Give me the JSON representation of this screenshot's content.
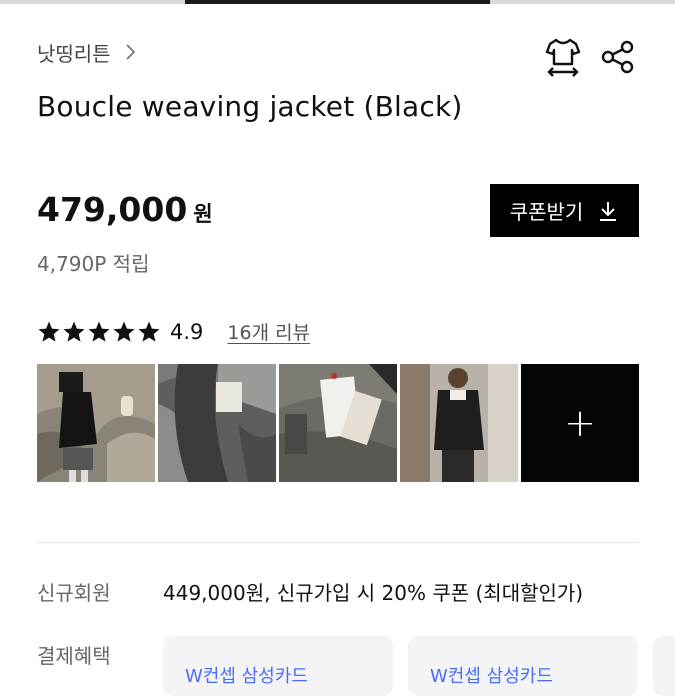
{
  "header": {
    "brand": "낫띵리튼",
    "icons": {
      "size_guide": "tshirt-size-icon",
      "share": "share-icon",
      "chevron": "chevron-right-icon"
    }
  },
  "product": {
    "title": "Boucle weaving jacket (Black)",
    "price": "479,000",
    "currency": "원",
    "points": "4,790P 적립",
    "coupon_button": "쿠폰받기"
  },
  "rating": {
    "stars": 5,
    "score": "4.9",
    "reviews_link": "16개 리뷰"
  },
  "gallery": {
    "thumbnails": [
      "review-photo-1",
      "review-photo-2",
      "review-photo-3",
      "review-photo-4"
    ],
    "more_icon": "plus-icon"
  },
  "benefits": {
    "member_label": "신규회원",
    "member_value": "449,000원, 신규가입 시 20% 쿠폰 (최대할인가)",
    "payment_label": "결제혜택",
    "cards": [
      "W컨셉 삼성카드",
      "W컨셉 삼성카드"
    ]
  },
  "colors": {
    "accent": "#000000",
    "card_bg": "#f4f4f6",
    "card_text": "#4a6cf7",
    "muted": "#666666"
  }
}
